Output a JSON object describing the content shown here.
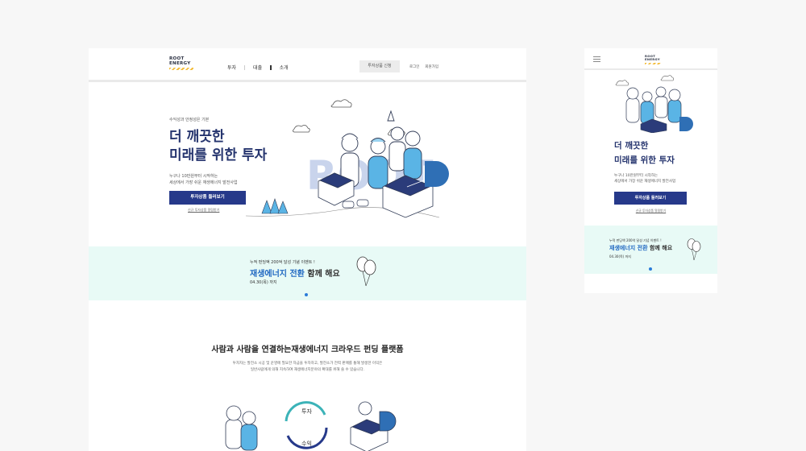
{
  "brand": {
    "logo_line1": "ROOT",
    "logo_line2": "ENERGY",
    "accent": "#f3bd3c",
    "primary": "#26398a",
    "title_color": "#25346e",
    "highlight": "#1f67c1",
    "banner_bg": "#e8faf6"
  },
  "nav": {
    "items": [
      "투자",
      "대출",
      "소개"
    ],
    "apply_label": "투자상품 신청",
    "login_label": "로그인",
    "signup_label": "회원가입"
  },
  "hero": {
    "kicker": "수익성과 안정성은 기본",
    "title_line1": "더 깨끗한",
    "title_line2": "미래를 위한 투자",
    "desc_line1": "누구나 10만원부터 시작하는",
    "desc_line2": "세상에서 가장 쉬운 재생에너지 발전사업",
    "cta_label": "투자상품 둘러보기",
    "sub_link": "신규 투자상품 알림받기"
  },
  "banner": {
    "small": "누적 펀딩액 200억 달성 기념 이벤트 !",
    "highlight": "재생에너지 전환",
    "rest": " 함께 해요",
    "date": "04.30(목) 까지"
  },
  "section": {
    "title": "사람과 사람을 연결하는재생에너지 크라우드 펀딩 플랫폼",
    "desc_line1": "투자자는 발전소 시공 및 운영에 필요한 자금을 투자하고, 발전소가 전력 판매를 통해 발생한 이익은",
    "desc_line2": "일반사람에게 의해 지속하여 재생에너지분야의 확대를 위해 쓸 수 있습니다.",
    "cycle_top": "투자",
    "cycle_bottom": "수익"
  },
  "icons": {
    "menu": "hamburger-icon",
    "cloud": "cloud-icon",
    "balloon": "balloon-icon",
    "people": "people-illustration"
  }
}
